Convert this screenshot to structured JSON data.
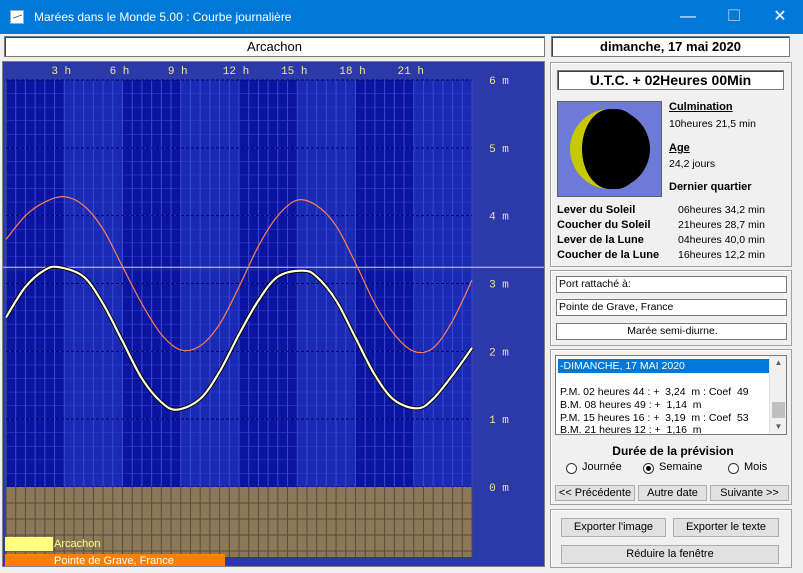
{
  "window": {
    "title": "Marées dans le Monde 5.00 : Courbe journalière",
    "minimize": "—",
    "maximize": "☐",
    "close": "✕"
  },
  "station": "Arcachon",
  "date": "dimanche, 17 mai 2020",
  "chart_data": {
    "type": "line",
    "x_ticks": [
      "3 h",
      "6 h",
      "9 h",
      "12 h",
      "15 h",
      "18 h",
      "21 h"
    ],
    "y_ticks": [
      "6 m",
      "5 m",
      "4 m",
      "3 m",
      "2 m",
      "1 m",
      "0 m"
    ],
    "xlim": [
      0,
      24
    ],
    "ylim": [
      0,
      6
    ],
    "night_hours": [
      [
        0,
        3
      ],
      [
        6,
        9
      ],
      [
        12,
        15
      ],
      [
        18,
        21
      ]
    ],
    "series": [
      {
        "name": "Arcachon",
        "color": "#ffffe0",
        "x": [
          0,
          1,
          2,
          2.73,
          4,
          5,
          6,
          7,
          8,
          8.82,
          10,
          11,
          12,
          13,
          14,
          15.27,
          16,
          17,
          18,
          19,
          20,
          21.2,
          22,
          23,
          24
        ],
        "values": [
          2.5,
          2.95,
          3.2,
          3.24,
          3.1,
          2.7,
          2.15,
          1.6,
          1.25,
          1.14,
          1.3,
          1.7,
          2.25,
          2.75,
          3.1,
          3.19,
          3.1,
          2.75,
          2.2,
          1.65,
          1.28,
          1.16,
          1.3,
          1.65,
          2.05
        ]
      },
      {
        "name": "Pointe de Grave, France",
        "color": "#ff7f50",
        "x": [
          0,
          1,
          2,
          3,
          4,
          5,
          6,
          7,
          8,
          9,
          10,
          11,
          12,
          13,
          14,
          15,
          16,
          17,
          18,
          19,
          20,
          21,
          22,
          23,
          24
        ],
        "values": [
          3.65,
          4.0,
          4.2,
          4.28,
          4.15,
          3.8,
          3.25,
          2.7,
          2.25,
          2.02,
          2.08,
          2.4,
          2.95,
          3.55,
          4.0,
          4.23,
          4.15,
          3.85,
          3.3,
          2.7,
          2.25,
          2.0,
          2.05,
          2.45,
          3.05
        ]
      }
    ],
    "reference_line": 3.24
  },
  "legend": [
    {
      "label": "Arcachon",
      "color": "#ffff80"
    },
    {
      "label": "Pointe de Grave, France",
      "color": "#ff8000"
    }
  ],
  "panel": {
    "utc": "U.T.C. + 02Heures 00Min",
    "culmination_label": "Culmination",
    "culmination_value": "10heures 21,5 min",
    "age_label": "Age",
    "age_value": "24,2 jours",
    "phase": "Dernier quartier",
    "rise_set": [
      {
        "label": "Lever du Soleil",
        "value": "06heures 34,2 min"
      },
      {
        "label": "Coucher du Soleil",
        "value": "21heures 28,7 min"
      },
      {
        "label": "Lever de la Lune",
        "value": "04heures 40,0 min"
      },
      {
        "label": "Coucher de la Lune",
        "value": "16heures 12,2 min"
      }
    ],
    "port_label": "Port rattaché à:",
    "port_value": "Pointe de Grave, France",
    "tide_type": "Marée semi-diurne."
  },
  "tide_list": {
    "selected": "-DIMANCHE, 17 MAI 2020",
    "rows": [
      "P.M. 02 heures 44 : +  3,24  m : Coef  49",
      "B.M. 08 heures 49 : +  1,14  m",
      "P.M. 15 heures 16 : +  3,19  m : Coef  53",
      "B.M. 21 heures 12 : +  1,16  m"
    ]
  },
  "duree": {
    "label": "Durée de la prévision",
    "options": [
      "Journée",
      "Semaine",
      "Mois"
    ],
    "selected": "Semaine"
  },
  "buttons": {
    "previous": "<< Précédente",
    "other_date": "Autre date",
    "next": "Suivante >>",
    "export_image": "Exporter l'image",
    "export_text": "Exporter le texte",
    "reduce": "Réduire la fenêtre"
  }
}
